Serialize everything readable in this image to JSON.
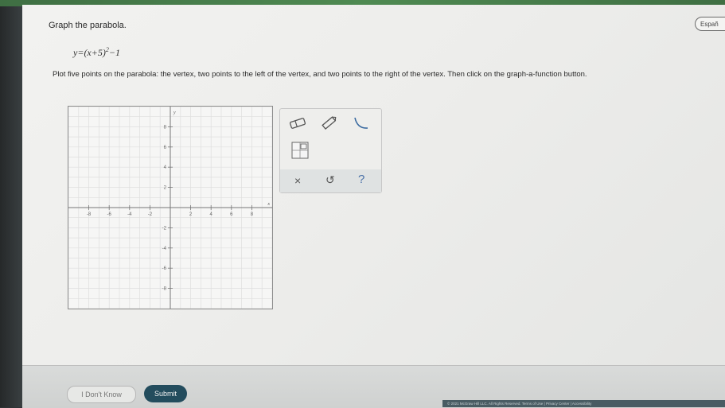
{
  "header": {
    "language_button": "Españ"
  },
  "problem": {
    "title": "Graph the parabola.",
    "equation": {
      "prefix": "y=",
      "body": "(x+5)",
      "exponent": "2",
      "suffix": "−1"
    },
    "instructions": "Plot five points on the parabola: the vertex, two points to the left of the vertex, and two points to the right of the vertex. Then click on the graph-a-function button."
  },
  "graph": {
    "x_axis_label": "x",
    "y_axis_label": "y",
    "x_ticks": [
      "-8",
      "-6",
      "-4",
      "-2",
      "2",
      "4",
      "6",
      "8"
    ],
    "y_ticks": [
      "8",
      "6",
      "4",
      "2",
      "-2",
      "-4",
      "-6",
      "-8"
    ],
    "x_range": [
      -10,
      10
    ],
    "y_range": [
      -10,
      10
    ]
  },
  "toolbar": {
    "tools": [
      "eraser-icon",
      "pencil-icon",
      "parabola-icon",
      "function-table-icon"
    ],
    "clear_symbol": "×",
    "undo_symbol": "↺",
    "help_symbol": "?"
  },
  "actions": {
    "dont_know_label": "I Don't Know",
    "submit_label": "Submit"
  },
  "footer": {
    "text": "© 2021 McGraw Hill LLC. All Rights Reserved.   Terms of Use  |  Privacy Center  |  Accessibility"
  }
}
